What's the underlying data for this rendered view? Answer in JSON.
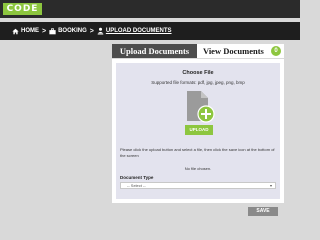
{
  "header": {
    "logo_text": "CODE",
    "logo_color": "#8dc63f"
  },
  "breadcrumb": {
    "items": [
      {
        "label": "HOME",
        "icon": "home-icon"
      },
      {
        "label": "BOOKING",
        "icon": "briefcase-icon"
      },
      {
        "label": "UPLOAD DOCUMENTS",
        "icon": "user-upload-icon"
      }
    ],
    "separator": ">"
  },
  "tabs": {
    "upload_label": "Upload Documents",
    "view_label": "View Documents",
    "view_badge": "0"
  },
  "upload_panel": {
    "title": "Choose File",
    "formats": "Supported file formats: pdf, jpg, jpeg, png, bmp",
    "file_icon": "file-add-icon",
    "upload_button": "UPLOAD",
    "instructions": "Please click the upload button and select a file, then click the save icon at the bottom of the screen",
    "no_file": "No file chosen.",
    "document_type_label": "Document Type",
    "document_type_value": "-- Select --"
  },
  "footer": {
    "save_label": "SAVE"
  },
  "colors": {
    "accent": "#8dc63f",
    "topbar": "#2b2b2b",
    "active_tab": "#4d4d4d"
  }
}
